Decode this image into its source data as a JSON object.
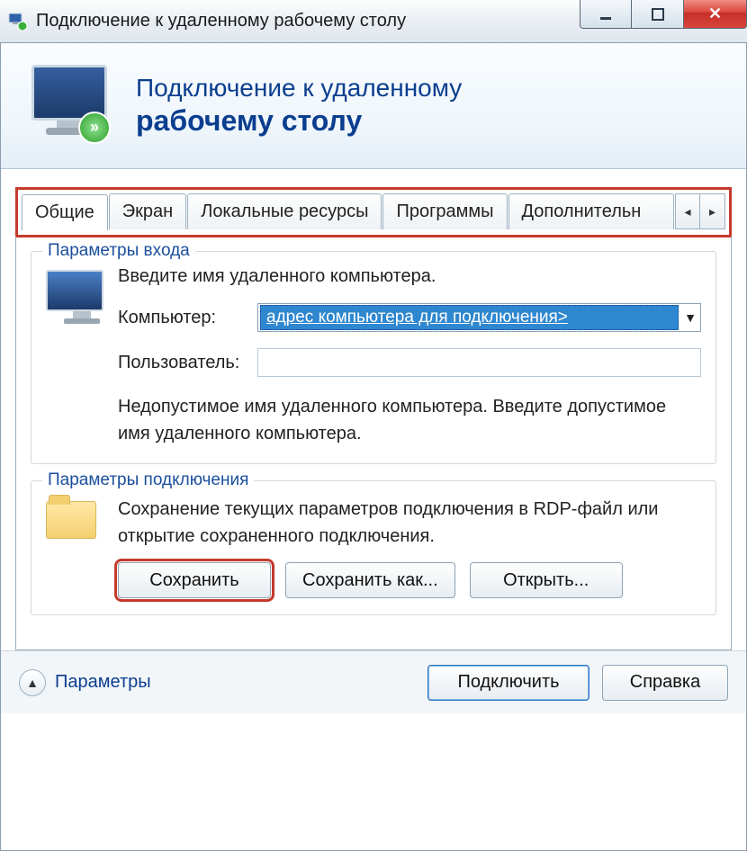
{
  "window": {
    "title": "Подключение к удаленному рабочему столу"
  },
  "banner": {
    "line1": "Подключение к удаленному",
    "line2": "рабочему столу",
    "badge_glyph": "»"
  },
  "tabs": {
    "items": [
      "Общие",
      "Экран",
      "Локальные ресурсы",
      "Программы",
      "Дополнительн"
    ],
    "scroll_left": "◂",
    "scroll_right": "▸"
  },
  "login_group": {
    "title": "Параметры входа",
    "instruction": "Введите имя удаленного компьютера.",
    "computer_label": "Компьютер:",
    "computer_value": "адрес компьютера для подключения>",
    "user_label": "Пользователь:",
    "user_value": "",
    "warning": "Недопустимое имя удаленного компьютера. Введите допустимое имя удаленного компьютера."
  },
  "conn_group": {
    "title": "Параметры подключения",
    "description": "Сохранение текущих параметров подключения в RDP-файл или открытие сохраненного подключения.",
    "save": "Сохранить",
    "save_as": "Сохранить как...",
    "open": "Открыть..."
  },
  "footer": {
    "collapse_glyph": "▲",
    "params": "Параметры",
    "connect": "Подключить",
    "help": "Справка"
  }
}
